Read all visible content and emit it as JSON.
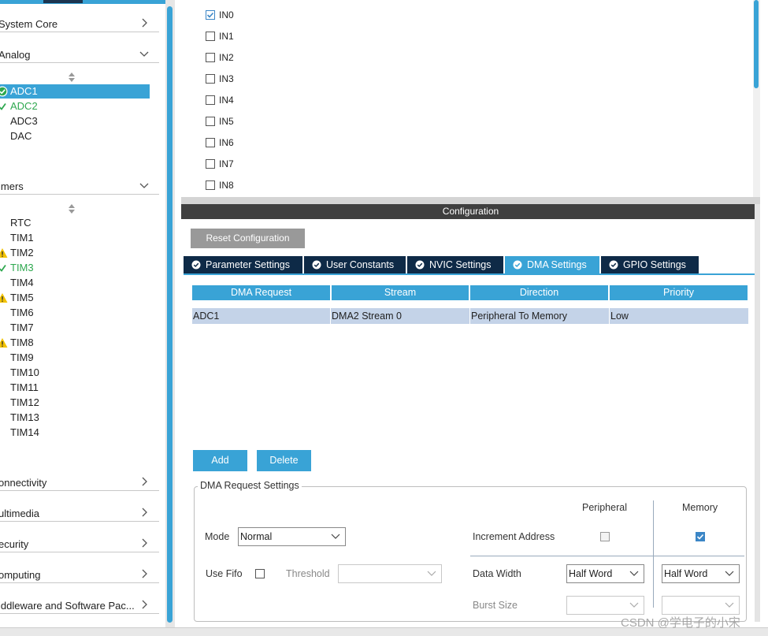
{
  "sidebar": {
    "categories": {
      "system_core": "System Core",
      "analog": "Analog",
      "timers": "imers",
      "connectivity": "onnectivity",
      "multimedia": "ultimedia",
      "security": "ecurity",
      "computing": "omputing",
      "middleware": "iddleware and Software Pac..."
    },
    "analog_items": [
      "ADC1",
      "ADC2",
      "ADC3",
      "DAC"
    ],
    "timer_items": [
      "RTC",
      "TIM1",
      "TIM2",
      "TIM3",
      "TIM4",
      "TIM5",
      "TIM6",
      "TIM7",
      "TIM8",
      "TIM9",
      "TIM10",
      "TIM11",
      "TIM12",
      "TIM13",
      "TIM14"
    ]
  },
  "channels": [
    "IN0",
    "IN1",
    "IN2",
    "IN3",
    "IN4",
    "IN5",
    "IN6",
    "IN7",
    "IN8"
  ],
  "config": {
    "title": "Configuration",
    "reset_label": "Reset Configuration",
    "tabs": [
      "Parameter Settings",
      "User Constants",
      "NVIC Settings",
      "DMA Settings",
      "GPIO Settings"
    ],
    "table": {
      "headers": [
        "DMA Request",
        "Stream",
        "Direction",
        "Priority"
      ],
      "rows": [
        [
          "ADC1",
          "DMA2 Stream 0",
          "Peripheral To Memory",
          "Low"
        ]
      ]
    },
    "add_label": "Add",
    "delete_label": "Delete",
    "request_settings": {
      "legend": "DMA Request Settings",
      "peripheral_header": "Peripheral",
      "memory_header": "Memory",
      "mode_label": "Mode",
      "mode_value": "Normal",
      "increment_label": "Increment Address",
      "use_fifo_label": "Use Fifo",
      "threshold_label": "Threshold",
      "data_width_label": "Data Width",
      "peripheral_width": "Half Word",
      "memory_width": "Half Word",
      "burst_size_label": "Burst Size"
    }
  },
  "watermark": "CSDN @学电子的小宋",
  "colors": {
    "accent": "#39a3d6",
    "tab_dark": "#0e2a47",
    "ok_green": "#2ea84f",
    "warn_yellow": "#f2c200"
  }
}
